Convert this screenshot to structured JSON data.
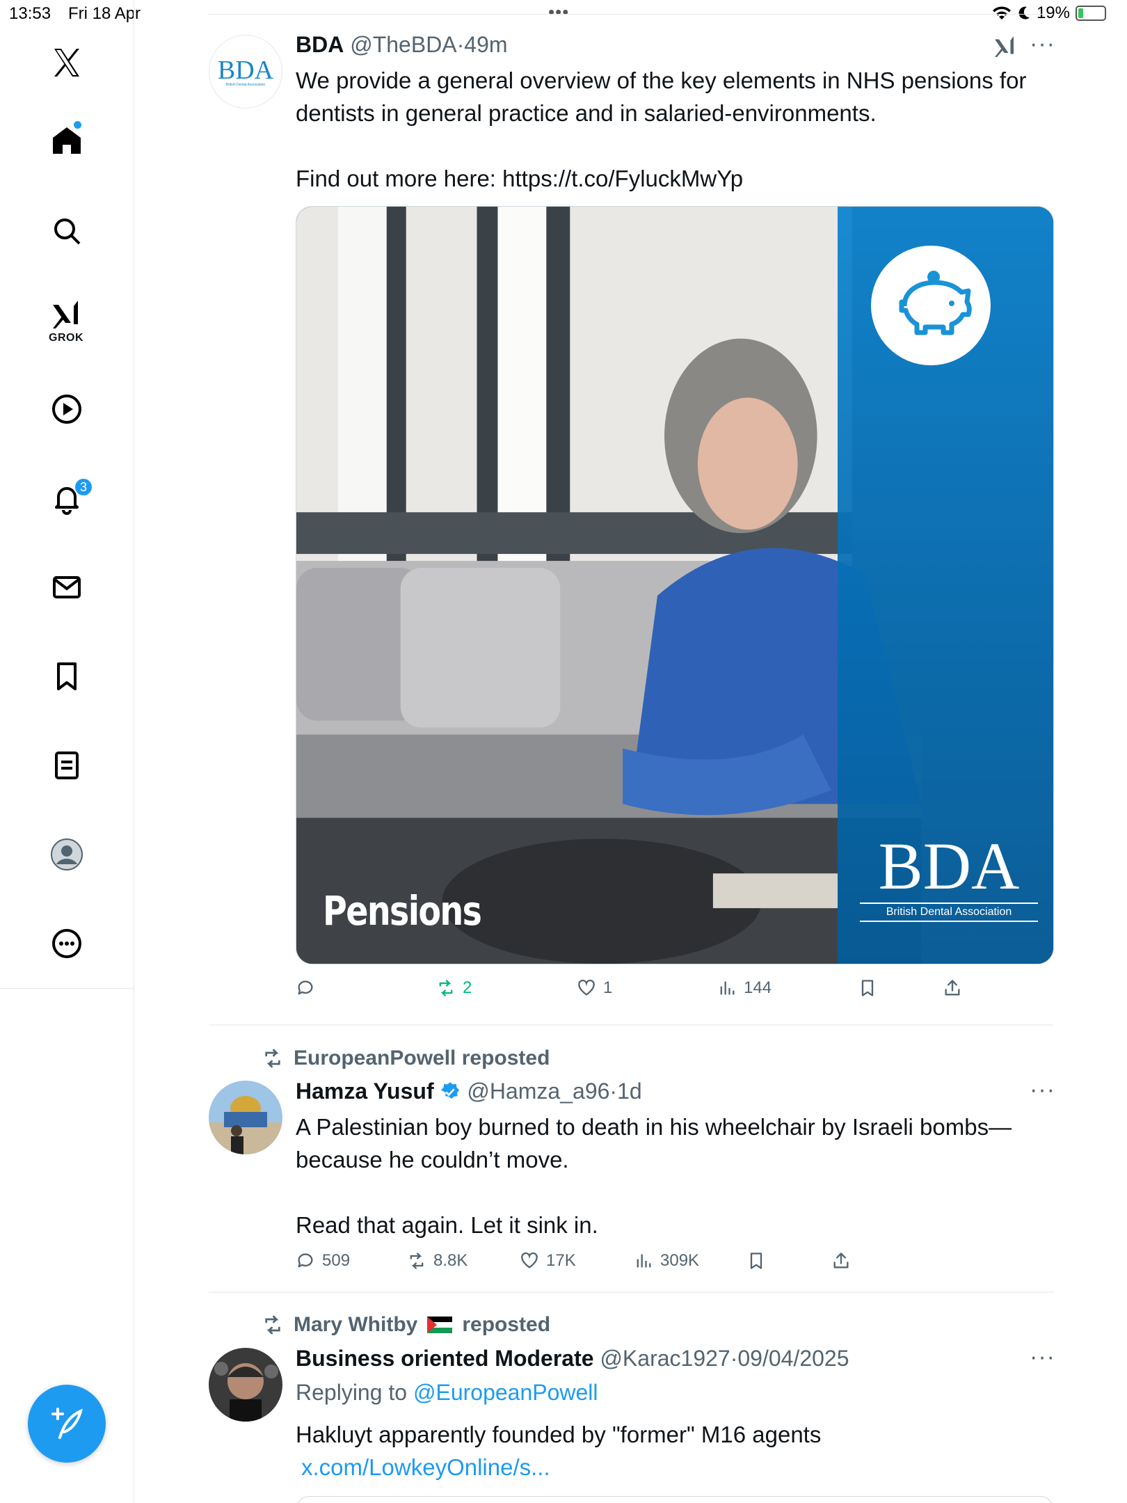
{
  "status_bar": {
    "time": "13:53",
    "date": "Fri 18 Apr",
    "battery": "19%",
    "battery_level": 0.19
  },
  "sidebar": {
    "items": [
      {
        "name": "x-logo"
      },
      {
        "name": "home"
      },
      {
        "name": "search"
      },
      {
        "name": "grok",
        "label": "GROK"
      },
      {
        "name": "video"
      },
      {
        "name": "notifications",
        "badge": "3"
      },
      {
        "name": "messages"
      },
      {
        "name": "bookmarks"
      },
      {
        "name": "lists"
      },
      {
        "name": "profile"
      },
      {
        "name": "more"
      }
    ],
    "compose_icon": "feather-plus-icon"
  },
  "tweets": [
    {
      "display_name": "BDA",
      "handle": "@TheBDA",
      "time": "49m",
      "avatar_text": "BDA",
      "avatar_subtext": "British Dental Association",
      "text_line1": "We provide a general overview of the key elements in NHS pensions for",
      "text_line2": "dentists in general practice and in salaried-environments.",
      "text_line3": "Find out more here: https://t.co/FyluckMwYp",
      "media": {
        "caption": "Pensions",
        "logo": "BDA",
        "logo_sub": "British Dental Association",
        "icon": "piggy-bank-icon"
      },
      "actions": {
        "replies": "",
        "reposts": "2",
        "likes": "1",
        "views": "144"
      }
    },
    {
      "reposted_by": "EuropeanPowell reposted",
      "display_name": "Hamza Yusuf",
      "verified": true,
      "handle": "@Hamza_a96",
      "time": "1d",
      "text_line1": "A Palestinian boy burned to death in his wheelchair by Israeli bombs—",
      "text_line2": "because he couldn’t move.",
      "text_line3": "Read that again. Let it sink in.",
      "actions": {
        "replies": "509",
        "reposts": "8.8K",
        "likes": "17K",
        "views": "309K"
      }
    },
    {
      "reposted_by_name": "Mary Whitby",
      "reposted_by_suffix": "reposted",
      "display_name": "Business oriented Moderate",
      "handle": "@Karac1927",
      "time": "09/04/2025",
      "replying_prefix": "Replying to",
      "replying_to": "@EuropeanPowell",
      "text_line1": "Hakluyt apparently founded by \"former\" M16 agents",
      "link": "x.com/LowkeyOnline/s..."
    }
  ],
  "colors": {
    "accent": "#1d9bf0",
    "repost_active": "#00ba7c",
    "muted": "#536471"
  }
}
